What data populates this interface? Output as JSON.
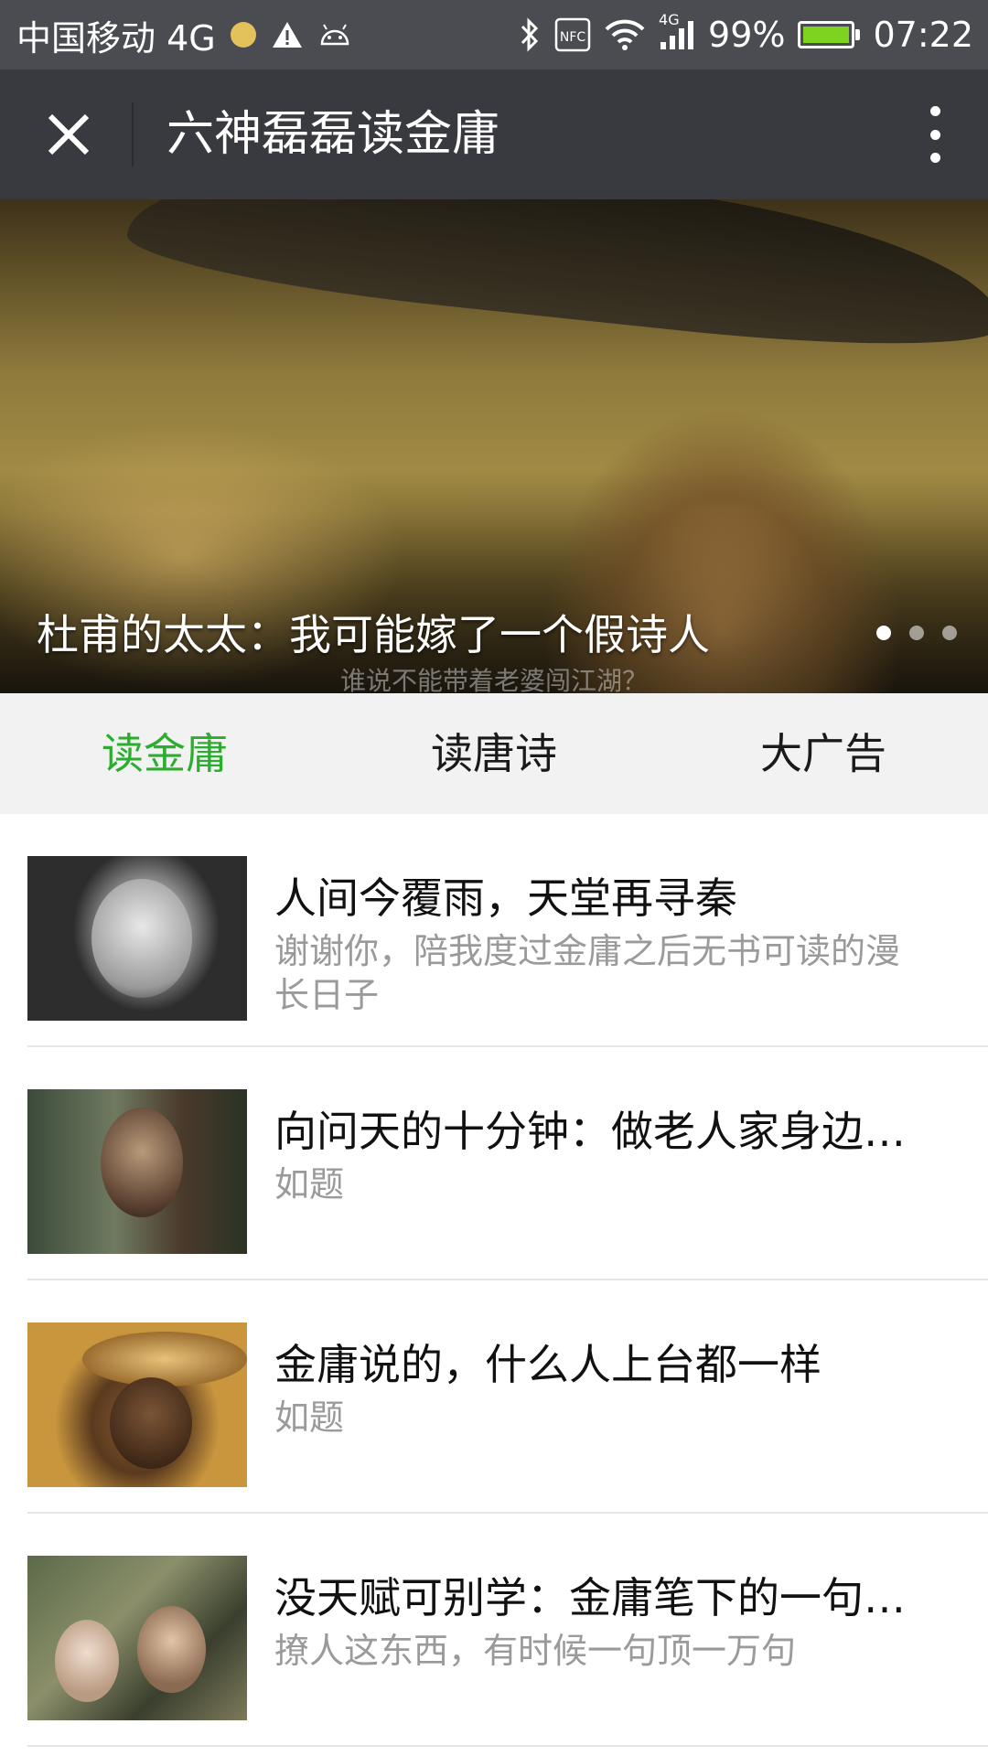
{
  "status_bar": {
    "carrier": "中国移动 4G",
    "network_badge": "4G",
    "battery": "99%",
    "battery_level": 0.99,
    "time": "07:22",
    "icons": [
      "warning-icon",
      "android-icon",
      "bluetooth-icon",
      "nfc-icon",
      "wifi-icon",
      "signal-icon",
      "battery-icon"
    ],
    "nfc_label": "NFC"
  },
  "titlebar": {
    "title": "六神磊磊读金庸"
  },
  "banner": {
    "title": "杜甫的太太：我可能嫁了一个假诗人",
    "subtitle": "谁说不能带着老婆闯江湖？",
    "active_dot": 0,
    "dot_count": 3
  },
  "tabs": [
    {
      "label": "读金庸",
      "active": true
    },
    {
      "label": "读唐诗",
      "active": false
    },
    {
      "label": "大广告",
      "active": false
    }
  ],
  "colors": {
    "accent": "#2bae2e",
    "titlebar": "#393a3f",
    "statusbar": "#4a4c52"
  },
  "articles": [
    {
      "title": "人间今覆雨，天堂再寻秦",
      "desc": "谢谢你，陪我度过金庸之后无书可读的漫长日子"
    },
    {
      "title": "向问天的十分钟：做老人家身边…",
      "desc": "如题"
    },
    {
      "title": "金庸说的，什么人上台都一样",
      "desc": "如题"
    },
    {
      "title": "没天赋可别学：金庸笔下的一句…",
      "desc": "撩人这东西，有时候一句顶一万句"
    }
  ]
}
